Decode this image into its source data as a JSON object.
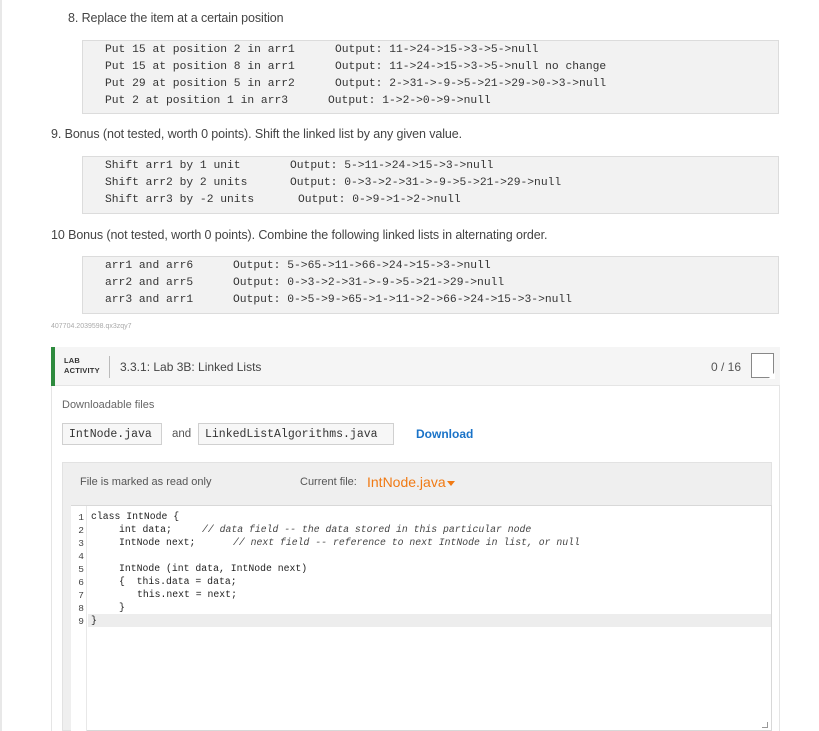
{
  "q8": {
    "title": "8. Replace the item at a certain position",
    "lines": [
      {
        "cmd": "Put 15 at position 2 in arr1",
        "out": "Output: 11->24->15->3->5->null"
      },
      {
        "cmd": "Put 15 at position 8 in arr1",
        "out": "Output: 11->24->15->3->5->null no change"
      },
      {
        "cmd": "Put 29 at position 5 in arr2",
        "out": "Output: 2->31->-9->5->21->29->0->3->null"
      },
      {
        "cmd": "Put 2 at position 1 in arr3",
        "out": "Output: 1->2->0->9->null"
      }
    ]
  },
  "q9": {
    "title": "9. Bonus (not tested, worth 0 points). Shift the linked list by any given value.",
    "lines": [
      {
        "cmd": "Shift arr1 by 1 unit",
        "out": "Output: 5->11->24->15->3->null"
      },
      {
        "cmd": "Shift arr2 by 2 units",
        "out": "Output: 0->3->2->31->-9->5->21->29->null"
      },
      {
        "cmd": "Shift arr3 by -2 units",
        "out": "Output: 0->9->1->2->null"
      }
    ]
  },
  "q10": {
    "title": "10 Bonus (not tested, worth 0 points). Combine the following linked lists in alternating order.",
    "lines": [
      {
        "cmd": "arr1 and arr6",
        "out": "Output: 5->65->11->66->24->15->3->null"
      },
      {
        "cmd": "arr2 and arr5",
        "out": "Output: 0->3->2->31->-9->5->21->29->null"
      },
      {
        "cmd": "arr3 and arr1",
        "out": "Output: 0->5->9->65->1->11->2->66->24->15->3->null"
      }
    ]
  },
  "hash_id": "407704.2039598.qx3zqy7",
  "lab": {
    "tag_line1": "LAB",
    "tag_line2": "ACTIVITY",
    "title": "3.3.1: Lab 3B: Linked Lists",
    "score": "0 / 16",
    "downloadable_label": "Downloadable files",
    "file1": "IntNode.java",
    "and_word": "and",
    "file2": "LinkedListAlgorithms.java",
    "download_label": "Download",
    "readonly_label": "File is marked as read only",
    "current_file_label": "Current file:",
    "current_file": "IntNode.java",
    "accent_color": "#2e8b3e",
    "link_color": "#1a73c8",
    "current_file_color": "#f07a14"
  },
  "code": {
    "line_numbers": [
      "1",
      "2",
      "3",
      "4",
      "5",
      "6",
      "7",
      "8",
      "9"
    ],
    "l1": "class IntNode {",
    "l2_code": "int data;",
    "l2_comment": "// data field -- the data stored in this particular node",
    "l3_code": "IntNode next;",
    "l3_comment": "// next field -- reference to next IntNode in list, or null",
    "l5": "IntNode (int data, IntNode next)",
    "l6": "{  this.data = data;",
    "l7": "this.next = next;",
    "l8": "}",
    "l9": "}"
  }
}
